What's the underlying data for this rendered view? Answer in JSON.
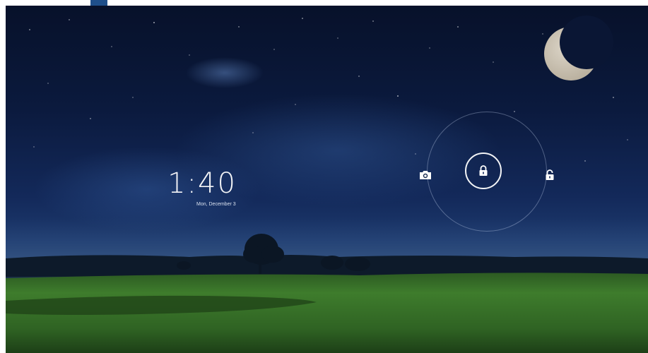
{
  "lockscreen": {
    "time": "1:40",
    "date": "Mon, December 3"
  },
  "icons": {
    "camera": "camera-icon",
    "lock": "lock-icon",
    "unlock": "unlock-icon"
  },
  "colors": {
    "sky_top": "#07112a",
    "sky_horizon": "#22406f",
    "field": "#3f7a2a",
    "accent": "#ffffff"
  }
}
